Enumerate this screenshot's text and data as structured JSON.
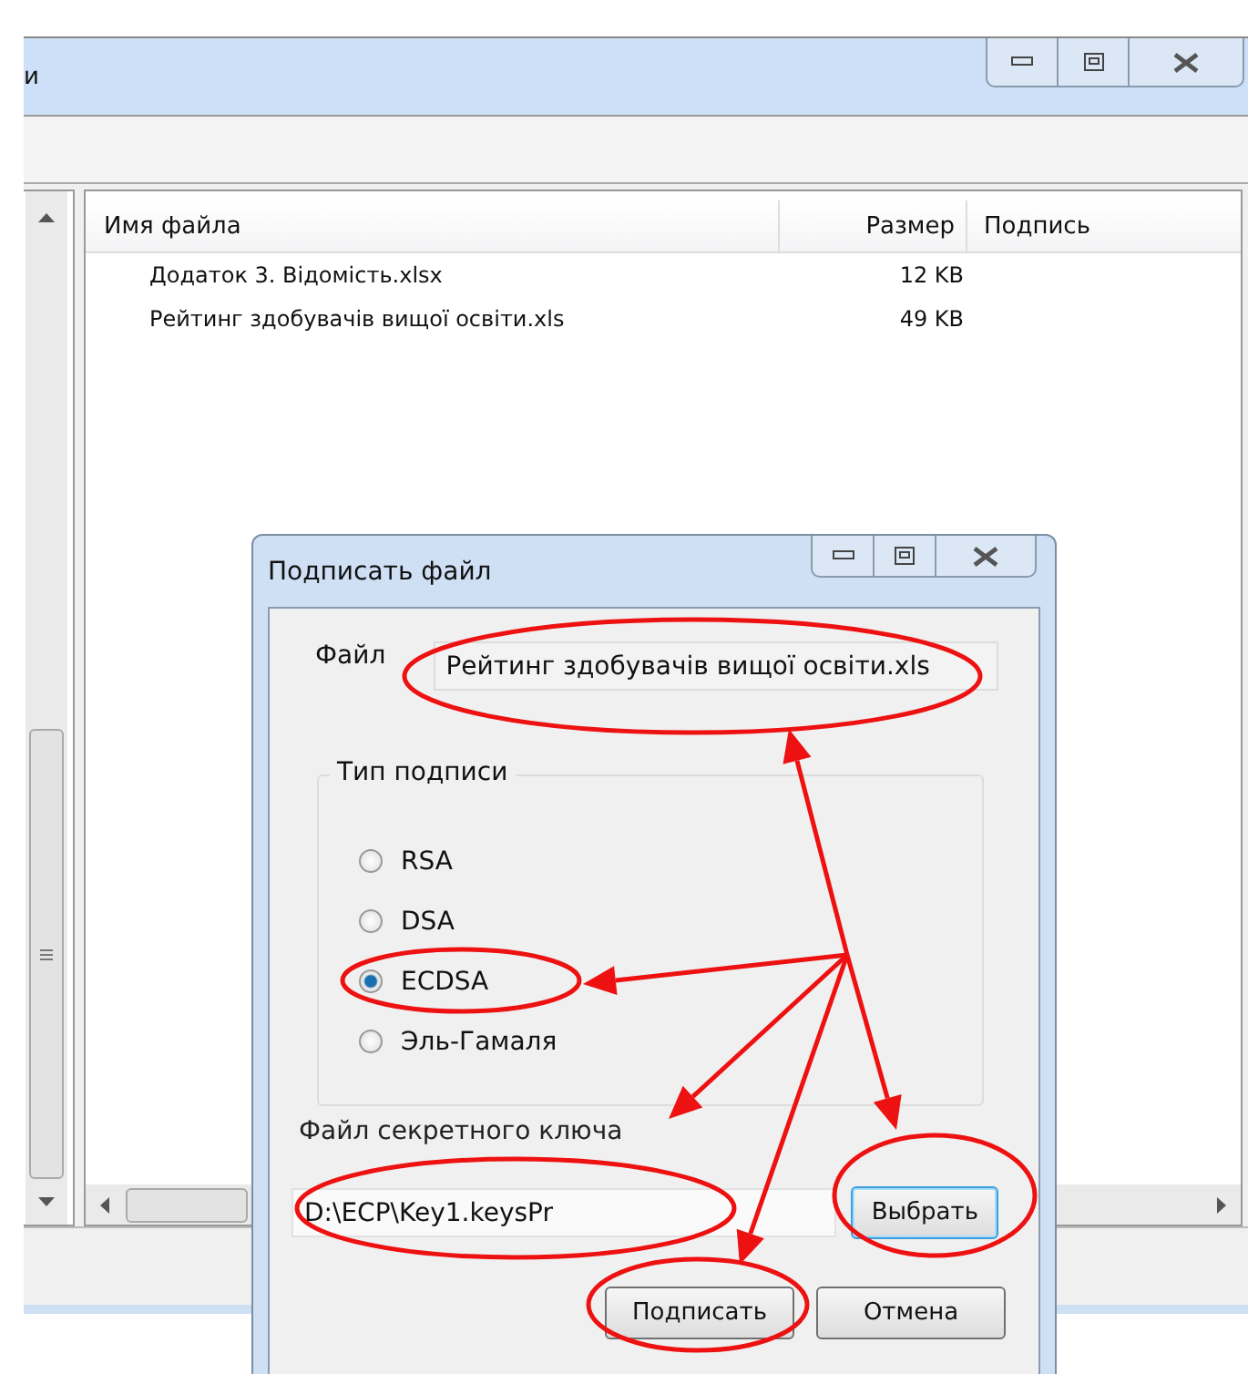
{
  "main_window": {
    "title": "и",
    "columns": [
      "Имя файла",
      "Размер",
      "Подпись"
    ],
    "files": [
      {
        "name": "Додаток 3. Відомість.xlsx",
        "size": "12 KB"
      },
      {
        "name": "Рейтинг здобувачів вищої освіти.xls",
        "size": "49 KB"
      }
    ]
  },
  "dialog": {
    "title": "Подписать файл",
    "file_label": "Файл",
    "file_value": "Рейтинг здобувачів вищої освіти.xls",
    "group_title": "Тип подписи",
    "options": [
      {
        "label": "RSA",
        "selected": false
      },
      {
        "label": "DSA",
        "selected": false
      },
      {
        "label": "ECDSA",
        "selected": true
      },
      {
        "label": "Эль-Гамаля",
        "selected": false
      }
    ],
    "key_label": "Файл секретного ключа",
    "key_value": "D:\\ECP\\Key1.keysPr",
    "browse_button": {
      "label": "Выбрать",
      "focused": true
    },
    "buttons": [
      {
        "label": "Подписать",
        "focused": false
      },
      {
        "label": "Отмена",
        "focused": false
      }
    ]
  }
}
